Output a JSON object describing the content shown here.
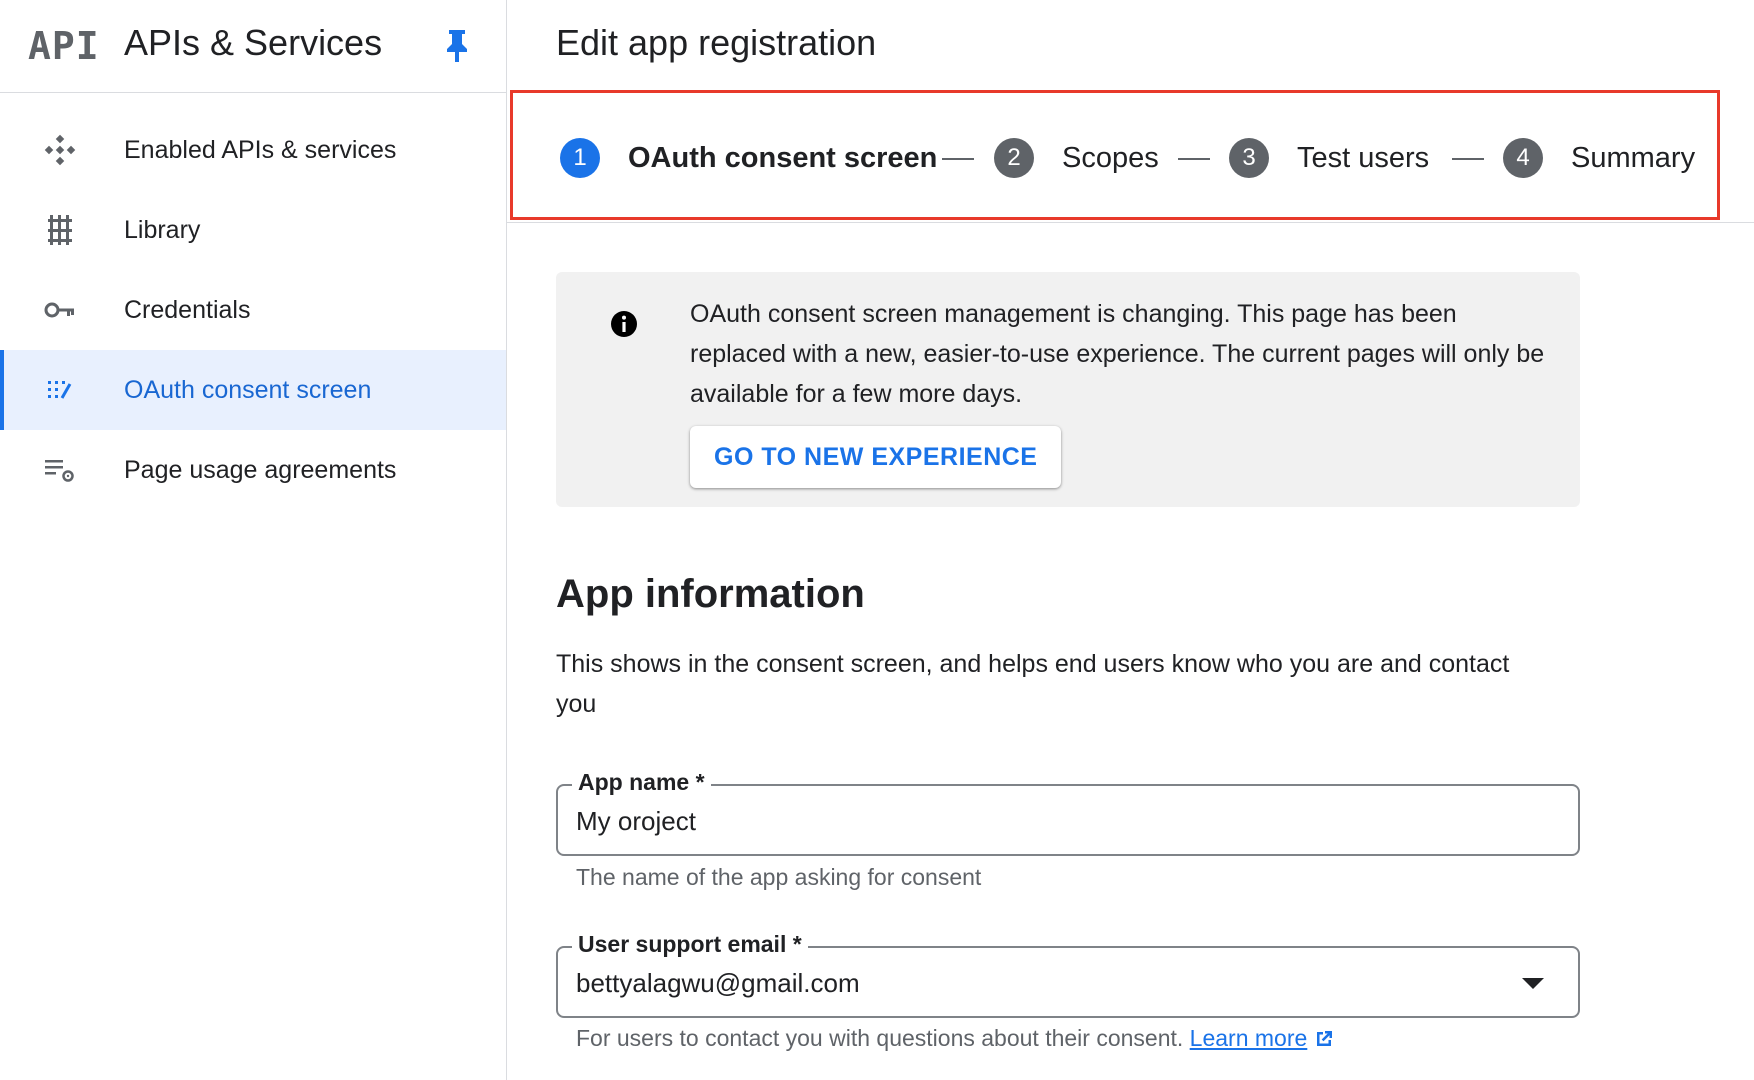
{
  "sidebar": {
    "logo": "API",
    "title": "APIs & Services",
    "pin_icon": "pin-icon",
    "items": [
      {
        "label": "Enabled APIs & services",
        "icon": "api-diamond-icon",
        "active": false
      },
      {
        "label": "Library",
        "icon": "library-icon",
        "active": false
      },
      {
        "label": "Credentials",
        "icon": "key-icon",
        "active": false
      },
      {
        "label": "OAuth consent screen",
        "icon": "consent-icon",
        "active": true
      },
      {
        "label": "Page usage agreements",
        "icon": "settings-list-icon",
        "active": false
      }
    ]
  },
  "main": {
    "title": "Edit app registration",
    "steps": [
      {
        "num": "1",
        "label": "OAuth consent screen",
        "active": true
      },
      {
        "num": "2",
        "label": "Scopes",
        "active": false
      },
      {
        "num": "3",
        "label": "Test users",
        "active": false
      },
      {
        "num": "4",
        "label": "Summary",
        "active": false
      }
    ],
    "info": {
      "icon": "info-icon",
      "text": "OAuth consent screen management is changing. This page has been replaced with a new, easier-to-use experience. The current pages will only be available for a few more days.",
      "button": "GO TO NEW EXPERIENCE"
    },
    "section_title": "App information",
    "section_desc": "This shows in the consent screen, and helps end users know who you are and contact you",
    "fields": {
      "app_name": {
        "label": "App name *",
        "value": "My oroject",
        "helper": "The name of the app asking for consent"
      },
      "support_email": {
        "label": "User support email *",
        "value": "bettyalagwu@gmail.com",
        "helper": "For users to contact you with questions about their consent.",
        "link": "Learn more"
      }
    }
  },
  "colors": {
    "accent": "#1a73e8",
    "highlight_border": "#e8392a",
    "active_bg": "#e8f0fe",
    "info_bg": "#f1f1f1"
  }
}
